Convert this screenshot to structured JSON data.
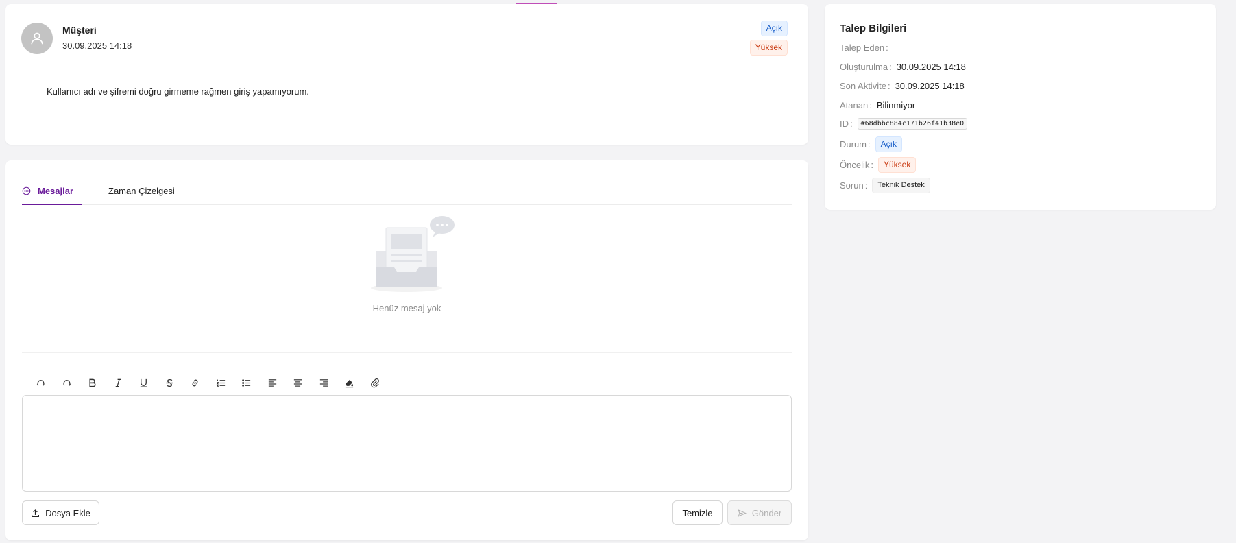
{
  "ticket": {
    "author": "Müşteri",
    "created_at": "30.09.2025 14:18",
    "status_tag": "Açık",
    "priority_tag": "Yüksek",
    "description": "Kullanıcı adı ve şifremi doğru girmeme rağmen giriş yapamıyorum."
  },
  "tabs": [
    {
      "label": "Mesajlar",
      "active": true
    },
    {
      "label": "Zaman Çizelgesi",
      "active": false
    }
  ],
  "messages": {
    "empty_text": "Henüz mesaj yok"
  },
  "toolbar": {
    "tools": [
      "undo-icon",
      "redo-icon",
      "bold-icon",
      "italic-icon",
      "underline-icon",
      "strikethrough-icon",
      "link-icon",
      "ordered-list-icon",
      "bullet-list-icon",
      "align-left-icon",
      "align-center-icon",
      "align-right-icon",
      "highlight-icon",
      "attachment-icon"
    ]
  },
  "actions": {
    "attach_label": "Dosya Ekle",
    "clear_label": "Temizle",
    "send_label": "Gönder"
  },
  "info": {
    "title": "Talep Bilgileri",
    "requester_label": "Talep Eden",
    "requester_value": "",
    "created_label": "Oluşturulma",
    "created_value": "30.09.2025 14:18",
    "last_activity_label": "Son Aktivite",
    "last_activity_value": "30.09.2025 14:18",
    "assignee_label": "Atanan",
    "assignee_value": "Bilinmiyor",
    "id_label": "ID",
    "id_value": "#68dbbc884c171b26f41b38e0",
    "status_label": "Durum",
    "status_value": "Açık",
    "priority_label": "Öncelik",
    "priority_value": "Yüksek",
    "issue_label": "Sorun",
    "issue_value": "Teknik Destek"
  },
  "colors": {
    "accent": "#6a1b9a",
    "status_blue": "#1a5fc9",
    "priority_red": "#c9380f"
  }
}
